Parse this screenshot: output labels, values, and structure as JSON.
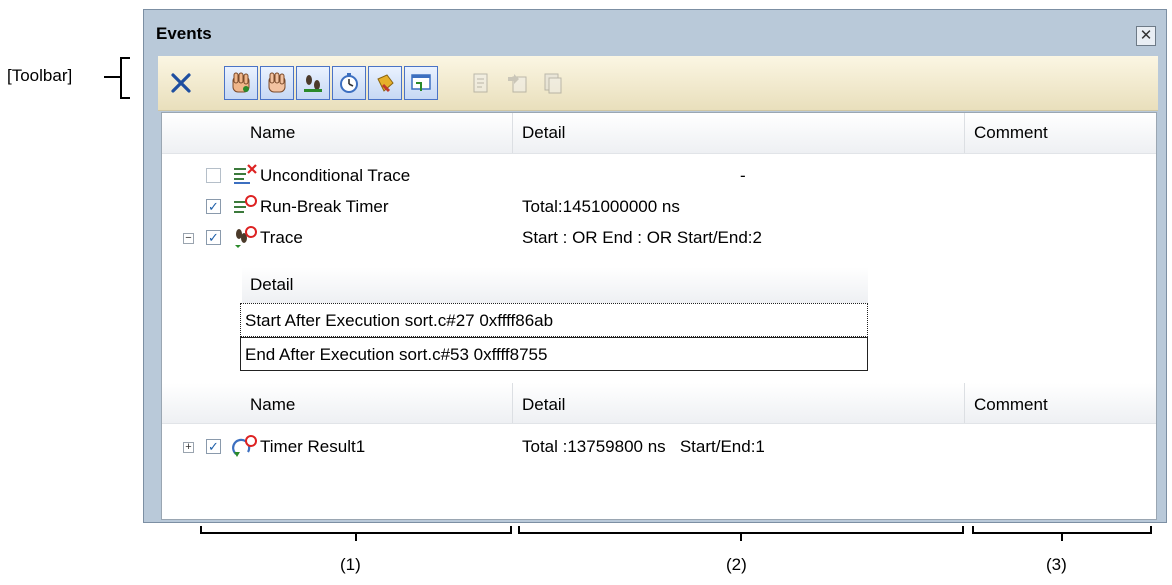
{
  "annotations": {
    "toolbar_label": "[Toolbar]",
    "col1": "(1)",
    "col2": "(2)",
    "col3": "(3)"
  },
  "window": {
    "title": "Events",
    "close_glyph": "✕"
  },
  "toolbar": {
    "buttons": [
      {
        "icon": "delete-icon",
        "state": "normal"
      },
      {
        "icon": "hardware-break-icon",
        "state": "on"
      },
      {
        "icon": "software-break-icon",
        "state": "on"
      },
      {
        "icon": "trace-icon",
        "state": "on"
      },
      {
        "icon": "timer-icon",
        "state": "on"
      },
      {
        "icon": "action-event-icon",
        "state": "on"
      },
      {
        "icon": "other-event-icon",
        "state": "on"
      },
      {
        "icon": "export-icon",
        "state": "disabled"
      },
      {
        "icon": "import-icon",
        "state": "disabled"
      },
      {
        "icon": "copy-icon",
        "state": "disabled"
      }
    ]
  },
  "list": {
    "headers": {
      "name": "Name",
      "detail": "Detail",
      "comment": "Comment"
    },
    "rows": [
      {
        "name": "Unconditional Trace",
        "detail": "-",
        "checked": false
      },
      {
        "name": "Run-Break Timer",
        "detail": "Total:1451000000 ns",
        "checked": true
      },
      {
        "name": "Trace",
        "detail": "Start : OR End : OR Start/End:2",
        "checked": true,
        "expander": "⊟"
      }
    ],
    "subtable": {
      "header": "Detail",
      "rows": [
        "Start After Execution sort.c#27 0xffff86ab",
        "End After Execution sort.c#53 0xffff8755"
      ]
    },
    "headers2": {
      "name": "Name",
      "detail": "Detail",
      "comment": "Comment"
    },
    "rows2": [
      {
        "name": "Timer Result1",
        "detail": "Total :13759800 ns   Start/End:1",
        "checked": true,
        "expander": "⊞"
      }
    ]
  },
  "colors": {
    "window_frame": "#b9c9d9",
    "toolbar_active_border": "#4a73c6"
  }
}
